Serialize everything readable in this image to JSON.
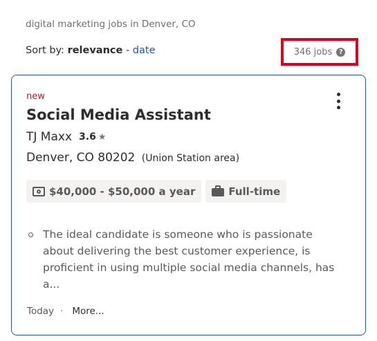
{
  "search": {
    "caption": "digital marketing jobs in Denver, CO",
    "sort_label": "Sort by:",
    "sort_active": "relevance",
    "sort_separator": "-",
    "sort_alt": "date",
    "result_count": "346 jobs",
    "help_glyph": "?"
  },
  "job": {
    "badge": "new",
    "title": "Social Media Assistant",
    "company": "TJ Maxx",
    "rating": "3.6",
    "rating_glyph": "★",
    "location": "Denver, CO 80202",
    "location_area": "(Union Station area)",
    "salary": "$40,000 - $50,000 a year",
    "job_type": "Full-time",
    "snippet": "The ideal candidate is someone who is passionate about delivering the best customer experience, is proficient in using multiple social media channels, has a...",
    "posted": "Today",
    "footer_separator": "·",
    "more_label": "More..."
  },
  "icons": {
    "salary": "money-icon",
    "job_type": "briefcase-icon",
    "menu": "kebab-menu-icon",
    "help": "help-icon",
    "rating": "star-icon"
  },
  "colors": {
    "link": "#2557a7",
    "highlight_box": "#e0001b",
    "new_badge": "#a9252b",
    "card_border": "#2557a7"
  }
}
